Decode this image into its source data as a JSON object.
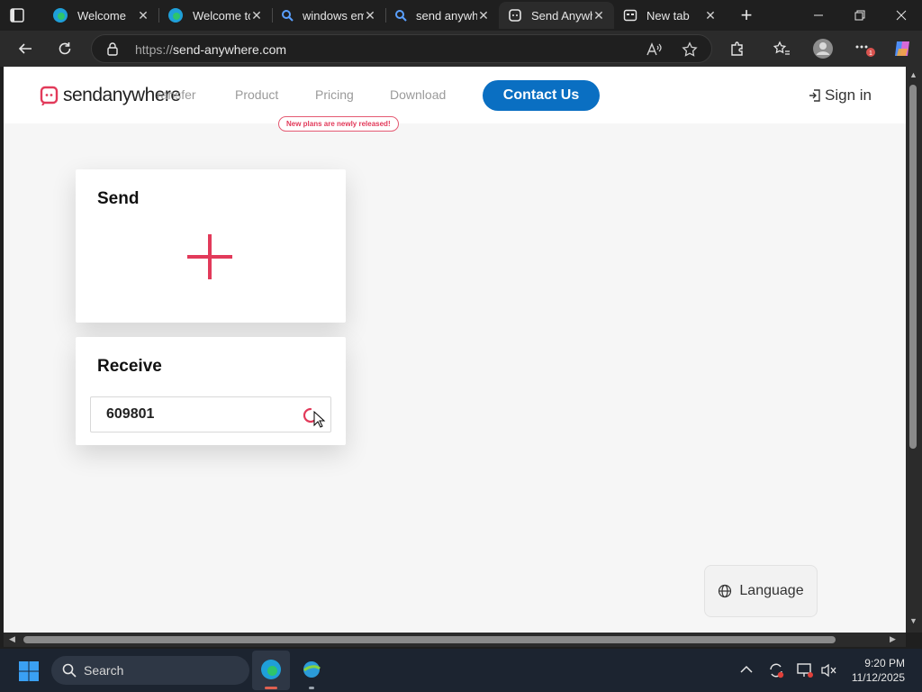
{
  "browser": {
    "tabs": [
      {
        "title": "Welcome",
        "icon": "edge-icon",
        "active": false
      },
      {
        "title": "Welcome to",
        "icon": "edge-icon",
        "active": false
      },
      {
        "title": "windows em",
        "icon": "search-icon",
        "active": false
      },
      {
        "title": "send anywh",
        "icon": "search-icon",
        "active": false
      },
      {
        "title": "Send Anywh",
        "icon": "sendanywhere-icon",
        "active": true
      },
      {
        "title": "New tab",
        "icon": "newtab-icon",
        "active": false
      }
    ],
    "close_glyph": "✕",
    "new_tab_glyph": "+",
    "address": {
      "scheme": "https://",
      "host": "send-anywhere.com"
    },
    "extension_badge": "1"
  },
  "site": {
    "logo": {
      "send": "send",
      "anywhere": "anywhere"
    },
    "nav": {
      "transfer": "ransfer",
      "product": "Product",
      "pricing": "Pricing",
      "download": "Download",
      "pricing_badge": "New plans are newly released!",
      "contact": "Contact Us",
      "signin": "Sign in"
    },
    "send": {
      "title": "Send"
    },
    "receive": {
      "title": "Receive",
      "key_value": "609801"
    },
    "language": "Language"
  },
  "colors": {
    "accent": "#e23a5a",
    "primary": "#0a6fc2"
  },
  "taskbar": {
    "search_placeholder": "Search",
    "time": "9:20 PM",
    "date": "11/12/2025"
  }
}
